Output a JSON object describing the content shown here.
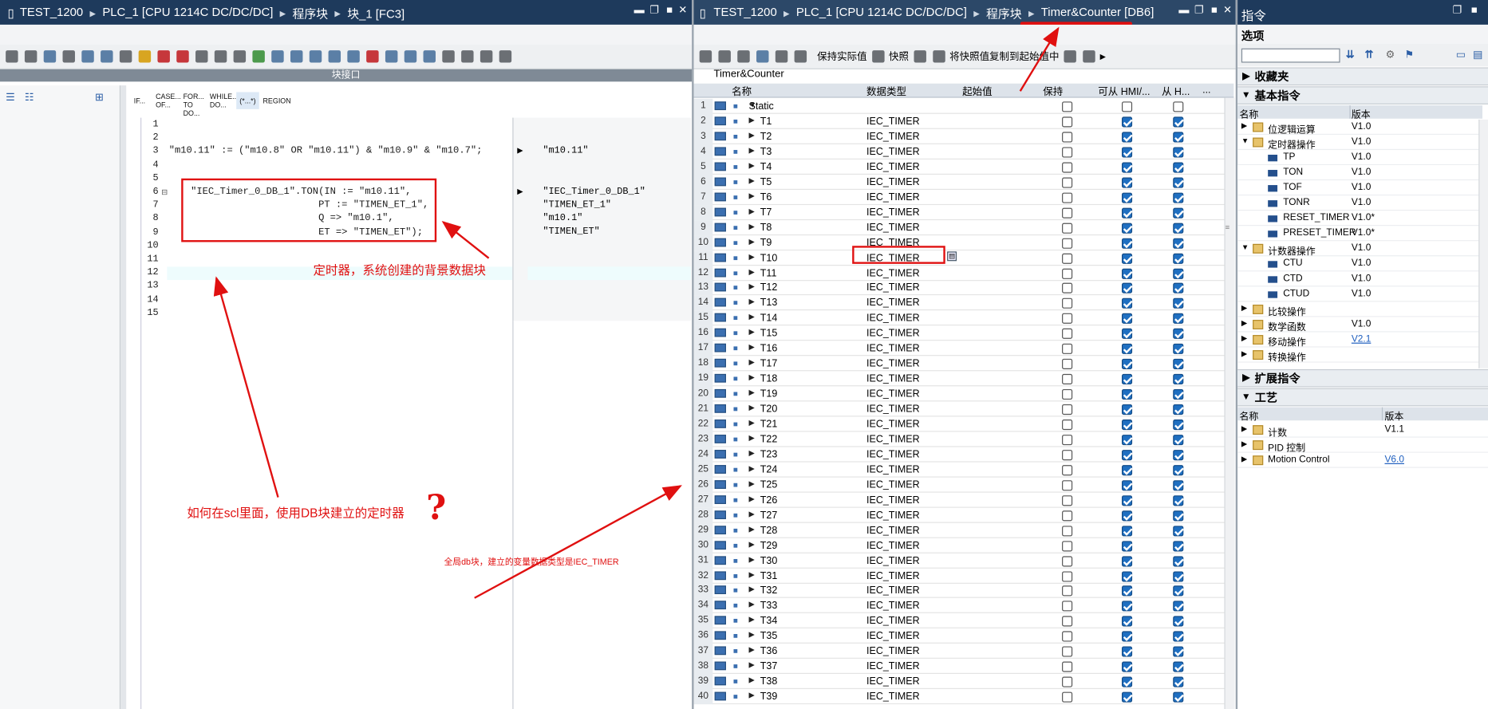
{
  "left": {
    "title": [
      "TEST_1200",
      "PLC_1 [CPU 1214C DC/DC/DC]",
      "程序块",
      "块_1 [FC3]"
    ],
    "interface_bar": "块接口",
    "snippets": [
      "IF...",
      "CASE... OF...",
      "FOR... TO DO...",
      "WHILE... DO...",
      "(*...*)",
      "REGION"
    ],
    "code": [
      {
        "n": "1",
        "t": ""
      },
      {
        "n": "2",
        "t": ""
      },
      {
        "n": "3",
        "t": "\"m10.11\" := (\"m10.8\" OR \"m10.11\") & \"m10.9\" & \"m10.7\";"
      },
      {
        "n": "4",
        "t": ""
      },
      {
        "n": "5",
        "t": ""
      },
      {
        "n": "6",
        "t": "\"IEC_Timer_0_DB_1\".TON(IN := \"m10.11\","
      },
      {
        "n": "7",
        "t": "                      PT := \"TIMEN_ET_1\","
      },
      {
        "n": "8",
        "t": "                      Q => \"m10.1\","
      },
      {
        "n": "9",
        "t": "                      ET => \"TIMEN_ET\");"
      },
      {
        "n": "10",
        "t": ""
      },
      {
        "n": "11",
        "t": ""
      },
      {
        "n": "12",
        "t": ""
      },
      {
        "n": "13",
        "t": ""
      },
      {
        "n": "14",
        "t": ""
      },
      {
        "n": "15",
        "t": ""
      }
    ],
    "cross": {
      "r3": "\"m10.11\"",
      "r6": "\"IEC_Timer_0_DB_1\"",
      "r7": "\"TIMEN_ET_1\"",
      "r8": "\"m10.1\"",
      "r9": "\"TIMEN_ET\""
    },
    "annotations": {
      "timer": "定时器，系统创建的背景数据块",
      "question": "如何在scl里面，使用DB块建立的定时器",
      "qmark": "?",
      "global": "全局db块，建立的变量数据类型是IEC_TIMER"
    }
  },
  "middle": {
    "title": [
      "TEST_1200",
      "PLC_1 [CPU 1214C DC/DC/DC]",
      "程序块",
      "Timer&Counter [DB6]"
    ],
    "toolbar": {
      "keep": "保持实际值",
      "snapshot": "快照",
      "copy": "将快照值复制到起始值中"
    },
    "db_name": "Timer&Counter",
    "columns": [
      "名称",
      "数据类型",
      "起始值",
      "保持",
      "可从 HMI/...",
      "从 H...",
      "..."
    ],
    "static_label": "Static",
    "type": "IEC_TIMER",
    "rows": [
      "T1",
      "T2",
      "T3",
      "T4",
      "T5",
      "T6",
      "T7",
      "T8",
      "T9",
      "T10",
      "T11",
      "T12",
      "T13",
      "T14",
      "T15",
      "T16",
      "T17",
      "T18",
      "T19",
      "T20",
      "T21",
      "T22",
      "T23",
      "T24",
      "T25",
      "T26",
      "T27",
      "T28",
      "T29",
      "T30",
      "T31",
      "T32",
      "T33",
      "T34",
      "T35",
      "T36",
      "T37",
      "T38",
      "T39"
    ]
  },
  "right": {
    "title": "指令",
    "options": "选项",
    "favorites": "收藏夹",
    "basic": "基本指令",
    "col_name": "名称",
    "col_ver": "版本",
    "items": [
      {
        "name": "位逻辑运算",
        "ver": "V1.0",
        "kind": "folder",
        "level": 0,
        "exp": "▶"
      },
      {
        "name": "定时器操作",
        "ver": "V1.0",
        "kind": "folder",
        "level": 0,
        "exp": "▼"
      },
      {
        "name": "TP",
        "ver": "V1.0",
        "kind": "block",
        "level": 1,
        "exp": ""
      },
      {
        "name": "TON",
        "ver": "V1.0",
        "kind": "block",
        "level": 1,
        "exp": ""
      },
      {
        "name": "TOF",
        "ver": "V1.0",
        "kind": "block",
        "level": 1,
        "exp": ""
      },
      {
        "name": "TONR",
        "ver": "V1.0",
        "kind": "block",
        "level": 1,
        "exp": ""
      },
      {
        "name": "RESET_TIMER",
        "ver": "V1.0*",
        "kind": "block",
        "level": 1,
        "exp": ""
      },
      {
        "name": "PRESET_TIMER",
        "ver": "V1.0*",
        "kind": "block",
        "level": 1,
        "exp": ""
      },
      {
        "name": "计数器操作",
        "ver": "V1.0",
        "kind": "folder",
        "level": 0,
        "exp": "▼"
      },
      {
        "name": "CTU",
        "ver": "V1.0",
        "kind": "block",
        "level": 1,
        "exp": ""
      },
      {
        "name": "CTD",
        "ver": "V1.0",
        "kind": "block",
        "level": 1,
        "exp": ""
      },
      {
        "name": "CTUD",
        "ver": "V1.0",
        "kind": "block",
        "level": 1,
        "exp": ""
      },
      {
        "name": "比较操作",
        "ver": "",
        "kind": "folder",
        "level": 0,
        "exp": "▶"
      },
      {
        "name": "数学函数",
        "ver": "V1.0",
        "kind": "folder",
        "level": 0,
        "exp": "▶"
      },
      {
        "name": "移动操作",
        "ver": "V2.1",
        "kind": "folder",
        "level": 0,
        "exp": "▶",
        "link": true
      },
      {
        "name": "转换操作",
        "ver": "",
        "kind": "folder",
        "level": 0,
        "exp": "▶"
      }
    ],
    "extended": "扩展指令",
    "tech": "工艺",
    "tech_items": [
      {
        "name": "计数",
        "ver": "V1.1"
      },
      {
        "name": "PID 控制",
        "ver": ""
      },
      {
        "name": "Motion Control",
        "ver": "V6.0",
        "link": true
      }
    ]
  }
}
